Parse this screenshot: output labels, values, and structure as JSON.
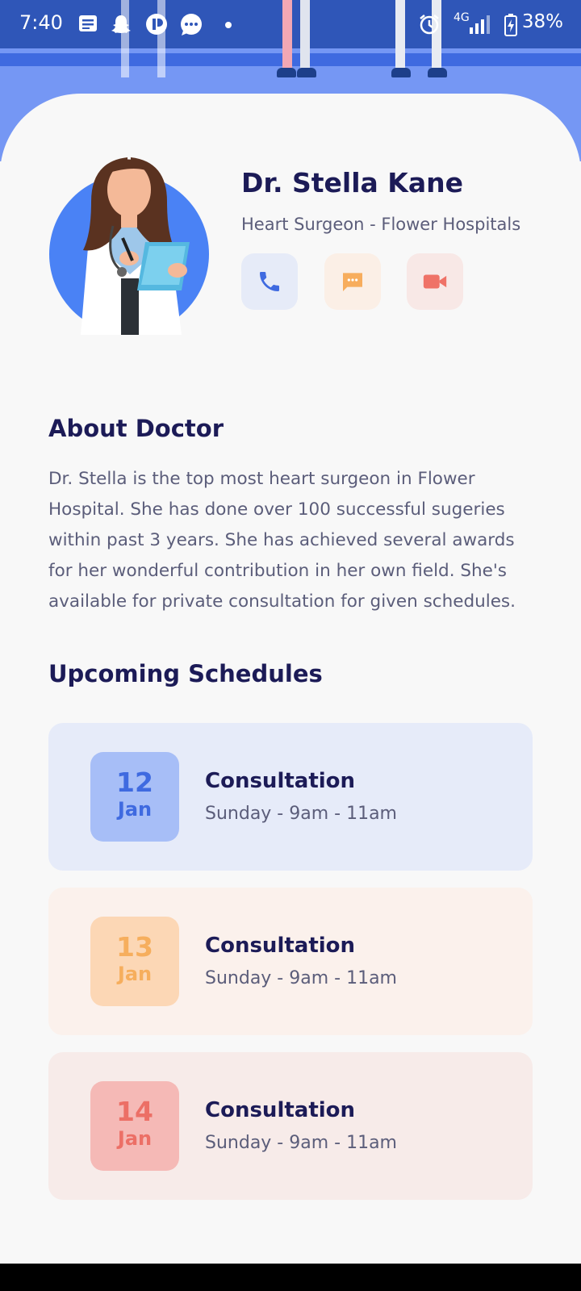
{
  "status_bar": {
    "time": "7:40",
    "network": "4G",
    "battery": "38%"
  },
  "doctor": {
    "name": "Dr. Stella Kane",
    "role": "Heart Surgeon - Flower Hospitals"
  },
  "actions": [
    {
      "icon": "phone-icon",
      "color": "#3f6ae0",
      "bg": "#e6ebf8"
    },
    {
      "icon": "chat-icon",
      "color": "#f7ad5d",
      "bg": "#fbefe6"
    },
    {
      "icon": "video-icon",
      "color": "#ef7267",
      "bg": "#f8e8e6"
    }
  ],
  "about": {
    "title": "About Doctor",
    "text": "Dr. Stella is the top most heart surgeon in Flower Hospital. She has done over 100 successful sugeries within past 3 years. She has achieved several awards for her wonderful contribution in her own field. She's available for private consultation for given schedules."
  },
  "schedules": {
    "title": "Upcoming Schedules",
    "items": [
      {
        "day": "12",
        "month": "Jan",
        "title": "Consultation",
        "time": "Sunday - 9am - 11am",
        "bg": "#e6ebf9",
        "box": "#a7bef7",
        "text_color": "#3f6ae0"
      },
      {
        "day": "13",
        "month": "Jan",
        "title": "Consultation",
        "time": "Sunday - 9am - 11am",
        "bg": "#fbf1ec",
        "box": "#fcd7b5",
        "text_color": "#f6ae5d"
      },
      {
        "day": "14",
        "month": "Jan",
        "title": "Consultation",
        "time": "Sunday - 9am - 11am",
        "bg": "#f7ebe9",
        "box": "#f5b9b6",
        "text_color": "#ec6f66"
      }
    ]
  }
}
